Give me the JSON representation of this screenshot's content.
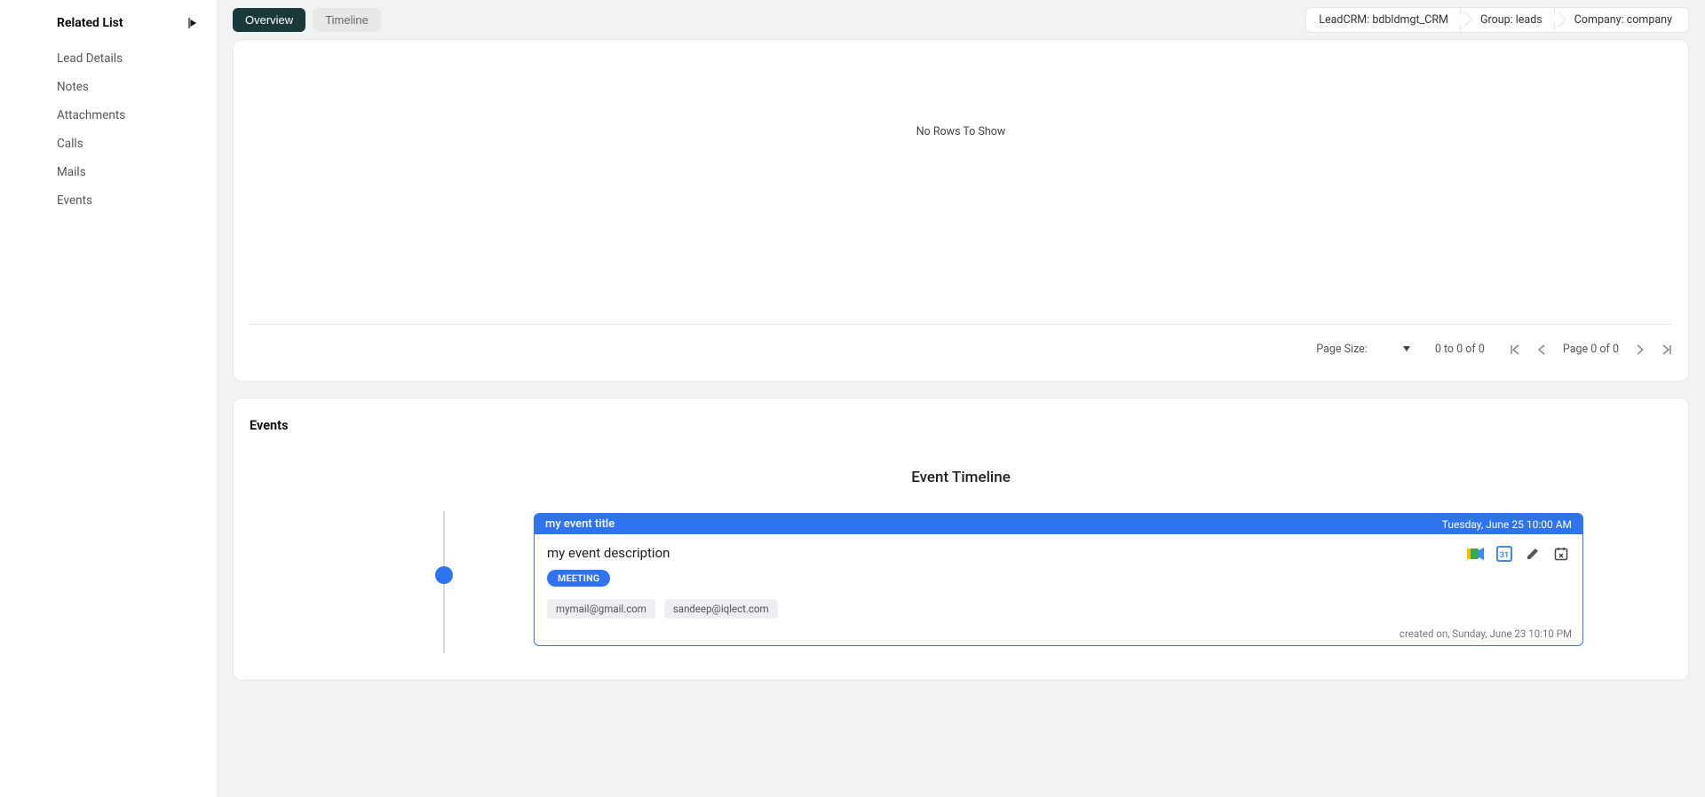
{
  "sidebar": {
    "title": "Related List",
    "items": [
      {
        "label": "Lead Details"
      },
      {
        "label": "Notes"
      },
      {
        "label": "Attachments"
      },
      {
        "label": "Calls"
      },
      {
        "label": "Mails"
      },
      {
        "label": "Events"
      }
    ]
  },
  "tabs": {
    "overview": "Overview",
    "timeline": "Timeline"
  },
  "breadcrumbs": {
    "crm": "LeadCRM: bdbldmgt_CRM",
    "group": "Group: leads",
    "company": "Company: company"
  },
  "grid": {
    "empty": "No Rows To Show",
    "page_size_label": "Page Size:",
    "range": "0 to 0 of 0",
    "page_of": "Page 0 of 0"
  },
  "events": {
    "section_title": "Events",
    "timeline_title": "Event Timeline",
    "card": {
      "title": "my event title",
      "datetime": "Tuesday, June 25 10:00 AM",
      "description": "my event description",
      "tag": "MEETING",
      "attendees": [
        "mymail@gmail.com",
        "sandeep@iqlect.com"
      ],
      "footer": "created on, Sunday, June 23 10:10 PM"
    }
  }
}
